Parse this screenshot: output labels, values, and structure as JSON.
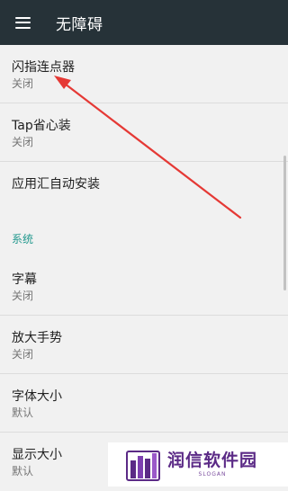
{
  "appbar": {
    "title": "无障碍",
    "menu_icon": "hamburger-menu-icon"
  },
  "items_top": [
    {
      "title": "闪指连点器",
      "subtitle": "关闭"
    },
    {
      "title": "Tap省心装",
      "subtitle": "关闭"
    },
    {
      "title": "应用汇自动安装",
      "subtitle": ""
    }
  ],
  "section": {
    "header": "系统"
  },
  "items_system": [
    {
      "title": "字幕",
      "subtitle": "关闭"
    },
    {
      "title": "放大手势",
      "subtitle": "关闭"
    },
    {
      "title": "字体大小",
      "subtitle": "默认"
    },
    {
      "title": "显示大小",
      "subtitle": "默认"
    }
  ],
  "watermark": {
    "name": "润信软件园",
    "slogan": "SLOGAN"
  },
  "colors": {
    "appbar": "#263238",
    "section_header": "#23998e",
    "annotation_arrow": "#e53935",
    "watermark": "#5b2a86"
  }
}
